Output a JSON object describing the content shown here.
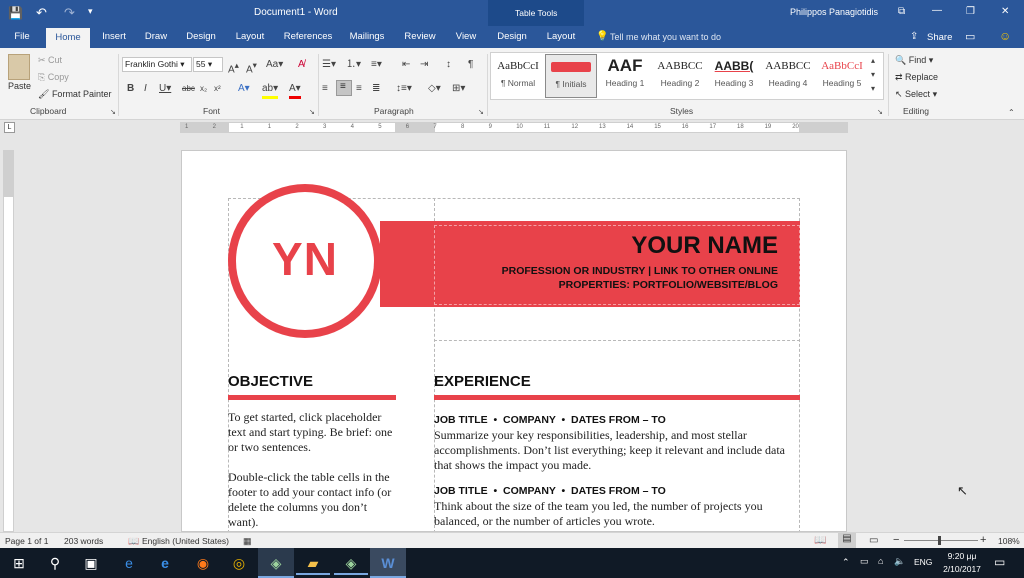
{
  "window": {
    "title": "Document1 - Word",
    "context_title": "Table Tools",
    "user": "Philippos Panagiotidis",
    "qat": {
      "save": "💾",
      "undo": "↶",
      "redo": "↷",
      "customize": "▾"
    },
    "controls": {
      "restore": "⧉",
      "minimize": "—",
      "maximize": "❐",
      "close": "✕"
    }
  },
  "tabs": [
    "File",
    "Home",
    "Insert",
    "Draw",
    "Design",
    "Layout",
    "References",
    "Mailings",
    "Review",
    "View",
    "Design",
    "Layout"
  ],
  "tell_me": "Tell me what you want to do",
  "share_label": "Share",
  "clipboard": {
    "paste": "Paste",
    "cut": "Cut",
    "copy": "Copy",
    "format_painter": "Format Painter",
    "label": "Clipboard"
  },
  "font": {
    "name": "Franklin Gothi",
    "size": "55",
    "label": "Font"
  },
  "paragraph": {
    "label": "Paragraph"
  },
  "styles": {
    "label": "Styles",
    "items": [
      {
        "preview": "AaBbCcI",
        "name": "¶ Normal"
      },
      {
        "preview": "",
        "name": "¶ Initials"
      },
      {
        "preview": "AAF",
        "name": "Heading 1"
      },
      {
        "preview": "AABBCC",
        "name": "Heading 2"
      },
      {
        "preview": "AABB(",
        "name": "Heading 3"
      },
      {
        "preview": "AABBCC",
        "name": "Heading 4"
      },
      {
        "preview": "AaBbCcI",
        "name": "Heading 5"
      }
    ]
  },
  "editing": {
    "find": "Find",
    "replace": "Replace",
    "select": "Select",
    "label": "Editing"
  },
  "ruler_numbers": [
    "1",
    "2",
    "1",
    "1",
    "2",
    "3",
    "4",
    "5",
    "6",
    "7",
    "8",
    "9",
    "10",
    "11",
    "12",
    "13",
    "14",
    "15",
    "16",
    "17",
    "18",
    "19",
    "20"
  ],
  "document": {
    "initials": "YN",
    "name": "YOUR NAME",
    "profession_line1": "PROFESSION OR INDUSTRY | LINK TO OTHER ONLINE",
    "profession_line2": "PROPERTIES: PORTFOLIO/WEBSITE/BLOG",
    "objective_heading": "OBJECTIVE",
    "objective_text": "To get started, click placeholder text and start typing. Be brief: one or two sentences.",
    "objective_text2": "Double-click the table cells in the footer to add your contact info (or delete the columns you don’t want).",
    "experience_heading": "EXPERIENCE",
    "job1_title": "JOB TITLE  •  COMPANY  •  DATES FROM – TO",
    "job1_text": "Summarize your key responsibilities, leadership, and most stellar accomplishments.  Don’t list everything; keep it relevant and include data that shows the impact you made.",
    "job2_title": "JOB TITLE  •  COMPANY  •  DATES FROM – TO",
    "job2_text": "Think about the size of the team you led, the number of projects you balanced, or the number of articles you wrote."
  },
  "status": {
    "page": "Page 1 of 1",
    "words": "203 words",
    "language": "English (United States)",
    "zoom": "108%"
  },
  "taskbar": {
    "time": "9:20 μμ",
    "date": "2/10/2017",
    "lang": "ENG"
  },
  "colors": {
    "accent": "#e8424a",
    "word_blue": "#2b579a"
  }
}
